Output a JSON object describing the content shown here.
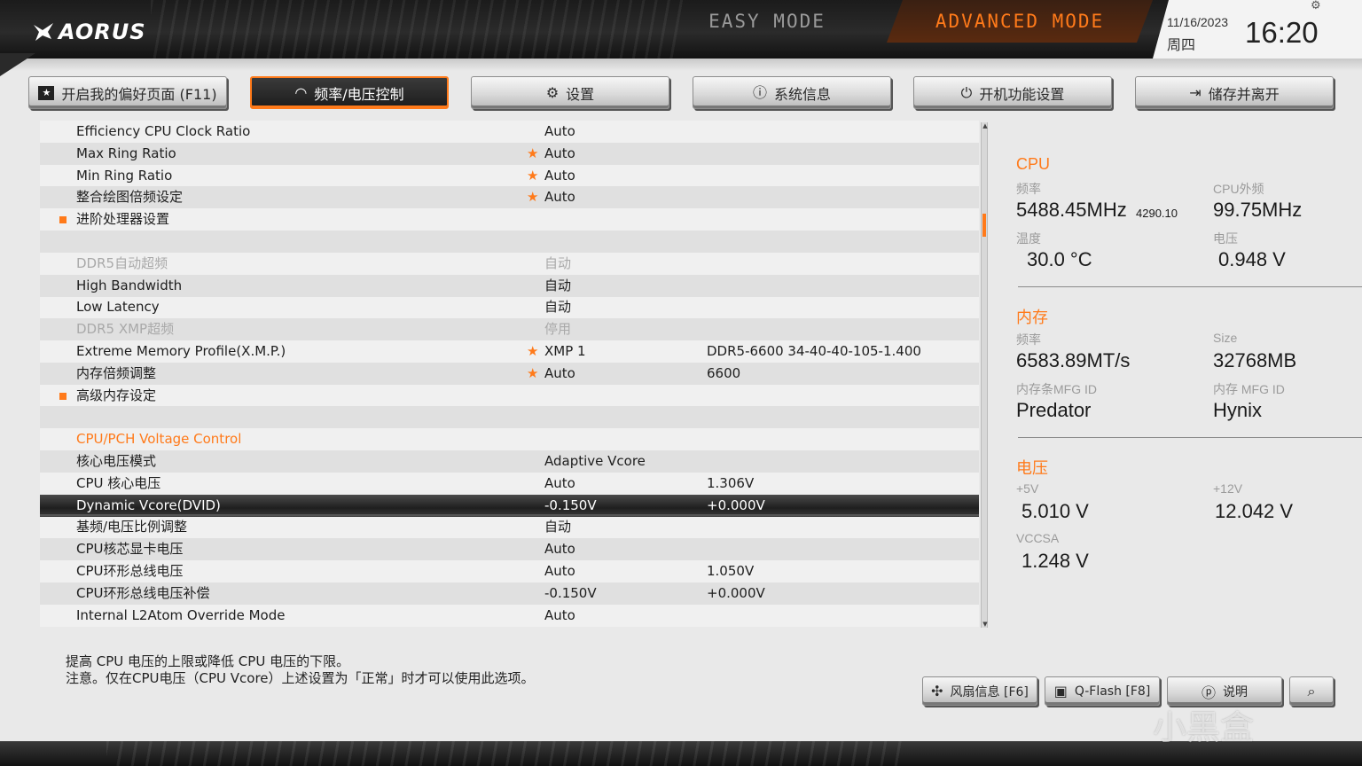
{
  "header": {
    "logo": "AORUS",
    "easy_mode": "EASY MODE",
    "advanced_mode": "ADVANCED MODE",
    "date": "11/16/2023",
    "weekday": "周四",
    "time": "16:20"
  },
  "tabs": [
    {
      "label": "开启我的偏好页面 (F11)",
      "icon": "favorite-page-icon"
    },
    {
      "label": "频率/电压控制",
      "icon": "speedometer-icon"
    },
    {
      "label": "设置",
      "icon": "gear-icon"
    },
    {
      "label": "系统信息",
      "icon": "info-icon"
    },
    {
      "label": "开机功能设置",
      "icon": "power-icon"
    },
    {
      "label": "储存并离开",
      "icon": "exit-icon"
    }
  ],
  "settings": [
    {
      "label": "Efficiency CPU Clock Ratio",
      "value": "Auto",
      "value2": "",
      "star": false,
      "alt": false
    },
    {
      "label": "Max Ring Ratio",
      "value": "Auto",
      "value2": "",
      "star": true,
      "alt": true
    },
    {
      "label": "Min Ring Ratio",
      "value": "Auto",
      "value2": "",
      "star": true,
      "alt": false
    },
    {
      "label": "整合绘图倍频设定",
      "value": "Auto",
      "value2": "",
      "star": true,
      "alt": true
    },
    {
      "label": "进阶处理器设置",
      "value": "",
      "value2": "",
      "bullet": true,
      "alt": false
    },
    {
      "label": "",
      "value": "",
      "value2": "",
      "alt": true
    },
    {
      "label": "DDR5自动超频",
      "value": "自动",
      "value2": "",
      "dim": true,
      "alt": false
    },
    {
      "label": "High Bandwidth",
      "value": "自动",
      "value2": "",
      "alt": true
    },
    {
      "label": "Low Latency",
      "value": "自动",
      "value2": "",
      "alt": false
    },
    {
      "label": "DDR5 XMP超频",
      "value": "停用",
      "value2": "",
      "dim": true,
      "alt": true
    },
    {
      "label": "Extreme Memory Profile(X.M.P.)",
      "value": "XMP 1",
      "value2": "DDR5-6600 34-40-40-105-1.400",
      "star": true,
      "alt": false
    },
    {
      "label": "内存倍频调整",
      "value": "Auto",
      "value2": "6600",
      "star": true,
      "alt": true
    },
    {
      "label": "高级内存设定",
      "value": "",
      "value2": "",
      "bullet": true,
      "alt": false
    },
    {
      "label": "",
      "value": "",
      "value2": "",
      "alt": true
    },
    {
      "label": "CPU/PCH Voltage Control",
      "value": "",
      "value2": "",
      "section": true,
      "alt": false
    },
    {
      "label": "核心电压模式",
      "value": "Adaptive Vcore",
      "value2": "",
      "alt": true
    },
    {
      "label": "CPU 核心电压",
      "value": "Auto",
      "value2": "1.306V",
      "alt": false
    },
    {
      "label": "Dynamic Vcore(DVID)",
      "value": "-0.150V",
      "value2": "+0.000V",
      "selected": true
    },
    {
      "label": "基频/电压比例调整",
      "value": "自动",
      "value2": "",
      "alt": false
    },
    {
      "label": "CPU核芯显卡电压",
      "value": "Auto",
      "value2": "",
      "alt": true
    },
    {
      "label": "CPU环形总线电压",
      "value": "Auto",
      "value2": "1.050V",
      "alt": false
    },
    {
      "label": "CPU环形总线电压补偿",
      "value": "-0.150V",
      "value2": "+0.000V",
      "alt": true
    },
    {
      "label": "Internal L2Atom Override Mode",
      "value": "Auto",
      "value2": "",
      "alt": false
    }
  ],
  "monitor": {
    "cpu": {
      "title": "CPU",
      "freq_label": "频率",
      "freq_value": "5488.45MHz",
      "freq_sub": "4290.10",
      "bclk_label": "CPU外频",
      "bclk_value": "99.75MHz",
      "temp_label": "温度",
      "temp_value": "30.0 °C",
      "volt_label": "电压",
      "volt_value": "0.948 V"
    },
    "memory": {
      "title": "内存",
      "freq_label": "频率",
      "freq_value": "6583.89MT/s",
      "size_label": "Size",
      "size_value": "32768MB",
      "mfg_label": "内存条MFG ID",
      "mfg_value": "Predator",
      "mfg2_label": "内存 MFG ID",
      "mfg2_value": "Hynix"
    },
    "voltage": {
      "title": "电压",
      "v5_label": "+5V",
      "v5_value": "5.010 V",
      "v12_label": "+12V",
      "v12_value": "12.042 V",
      "vccsa_label": "VCCSA",
      "vccsa_value": "1.248 V"
    }
  },
  "help": {
    "line1": "提高 CPU 电压的上限或降低 CPU 电压的下限。",
    "line2": "注意。仅在CPU电压（CPU Vcore）上述设置为「正常」时才可以使用此选项。"
  },
  "footer_buttons": [
    {
      "label": "风扇信息 [F6]",
      "icon": "fan-icon"
    },
    {
      "label": "Q-Flash [F8]",
      "icon": "chip-icon"
    },
    {
      "label": "说明",
      "icon": "help-icon"
    },
    {
      "label": "",
      "icon": "search-icon"
    }
  ],
  "watermark": "小黑盒",
  "colors": {
    "accent": "#ff7a1a",
    "dark": "#1d1d1d",
    "panel": "#f0f0f0"
  }
}
